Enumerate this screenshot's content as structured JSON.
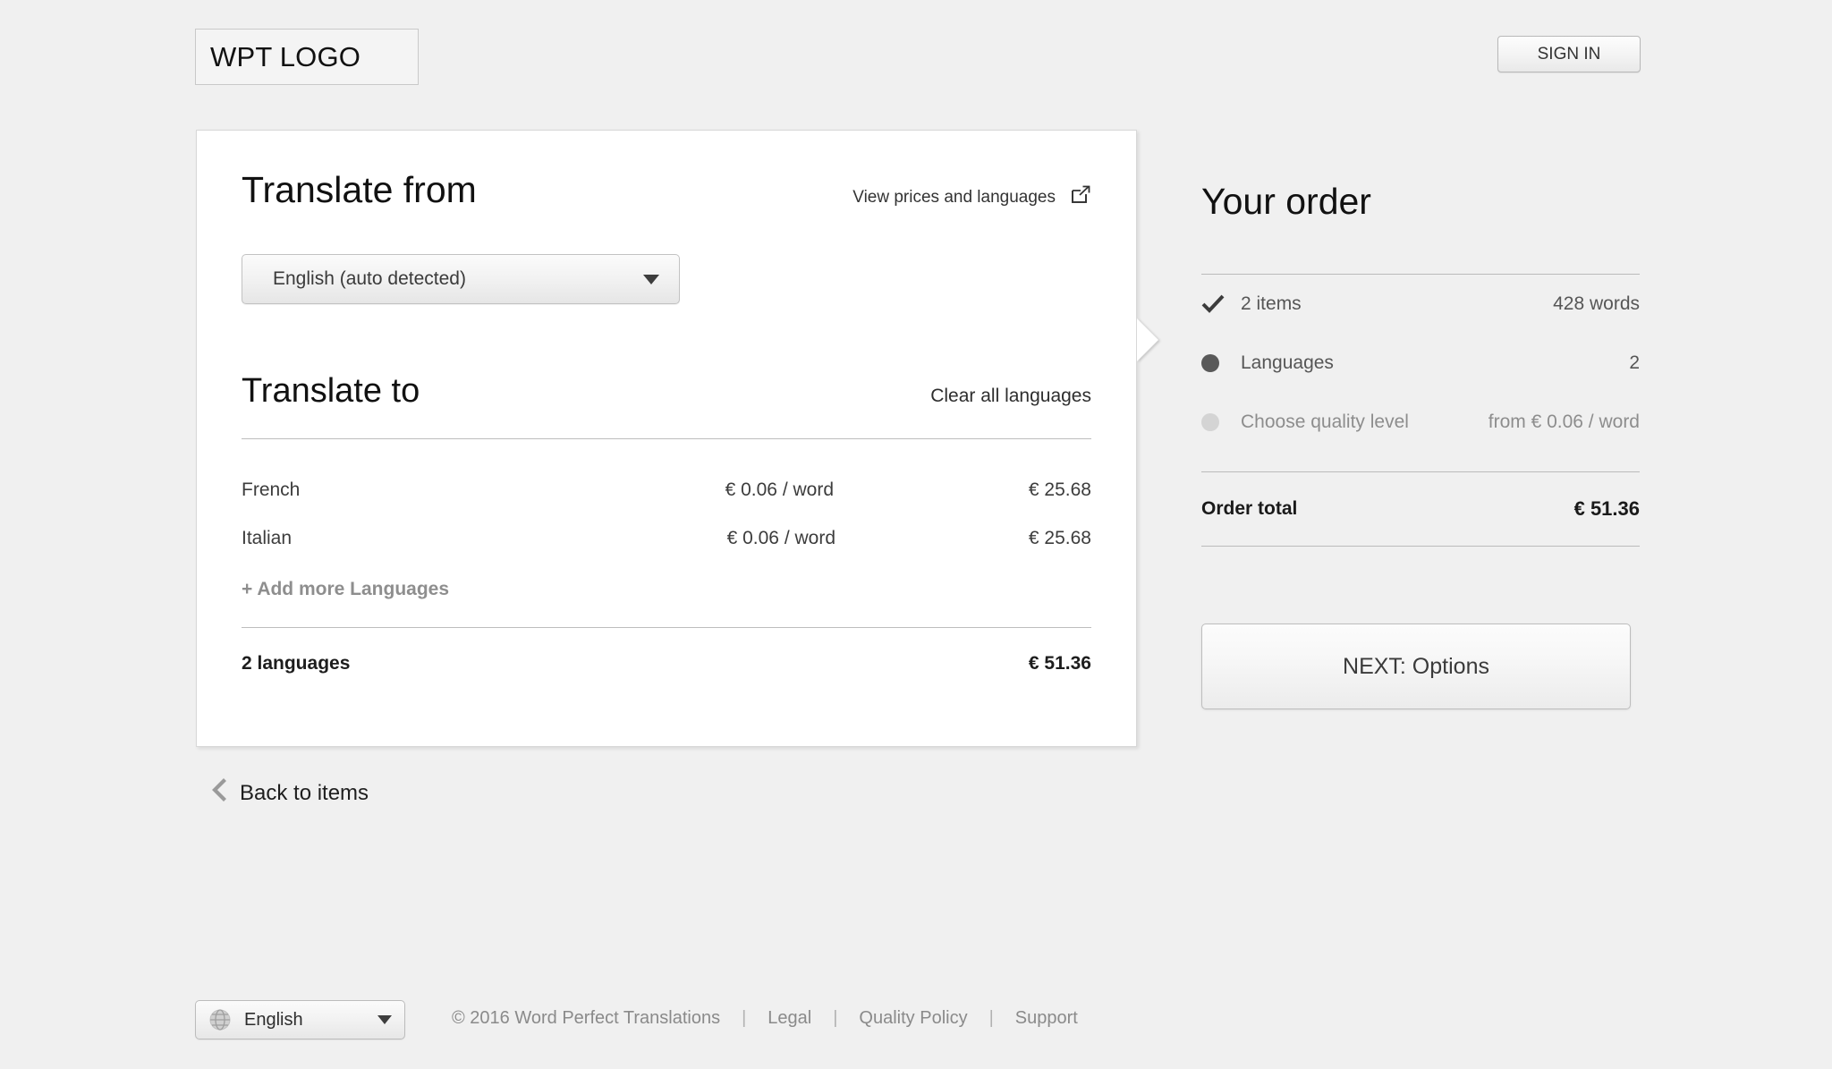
{
  "header": {
    "logo_text": "WPT LOGO",
    "signin_label": "SIGN IN"
  },
  "translate_from": {
    "title": "Translate from",
    "prices_link": "View prices and languages",
    "prices_icon": "external-link-icon",
    "source_language": "English (auto detected)"
  },
  "translate_to": {
    "title": "Translate to",
    "clear_link": "Clear all languages",
    "languages": [
      {
        "name": "French",
        "rate": "€ 0.06 / word",
        "amount": "€ 25.68"
      },
      {
        "name": "Italian",
        "rate": "€ 0.06 / word",
        "amount": "€ 25.68"
      }
    ],
    "add_more_label": "+ Add more Languages",
    "summary_label": "2 languages",
    "summary_amount": "€ 51.36"
  },
  "back_link": {
    "label": "Back to items",
    "icon": "chevron-left-icon"
  },
  "order": {
    "title": "Your order",
    "rows": [
      {
        "mark": "check-icon",
        "label": "2 items",
        "value": "428 words"
      },
      {
        "mark": "filled-dot-icon",
        "label": "Languages",
        "value": "2"
      },
      {
        "mark": "empty-dot-icon",
        "label": "Choose quality level",
        "value": "from € 0.06 / word"
      }
    ],
    "total_label": "Order total",
    "total_amount": "€ 51.36",
    "next_button": "NEXT: Options"
  },
  "footer": {
    "language_label": "English",
    "language_icon": "globe-icon",
    "copyright": "© 2016 Word Perfect Translations",
    "separator": "|",
    "links": [
      "Legal",
      "Quality Policy",
      "Support"
    ]
  }
}
